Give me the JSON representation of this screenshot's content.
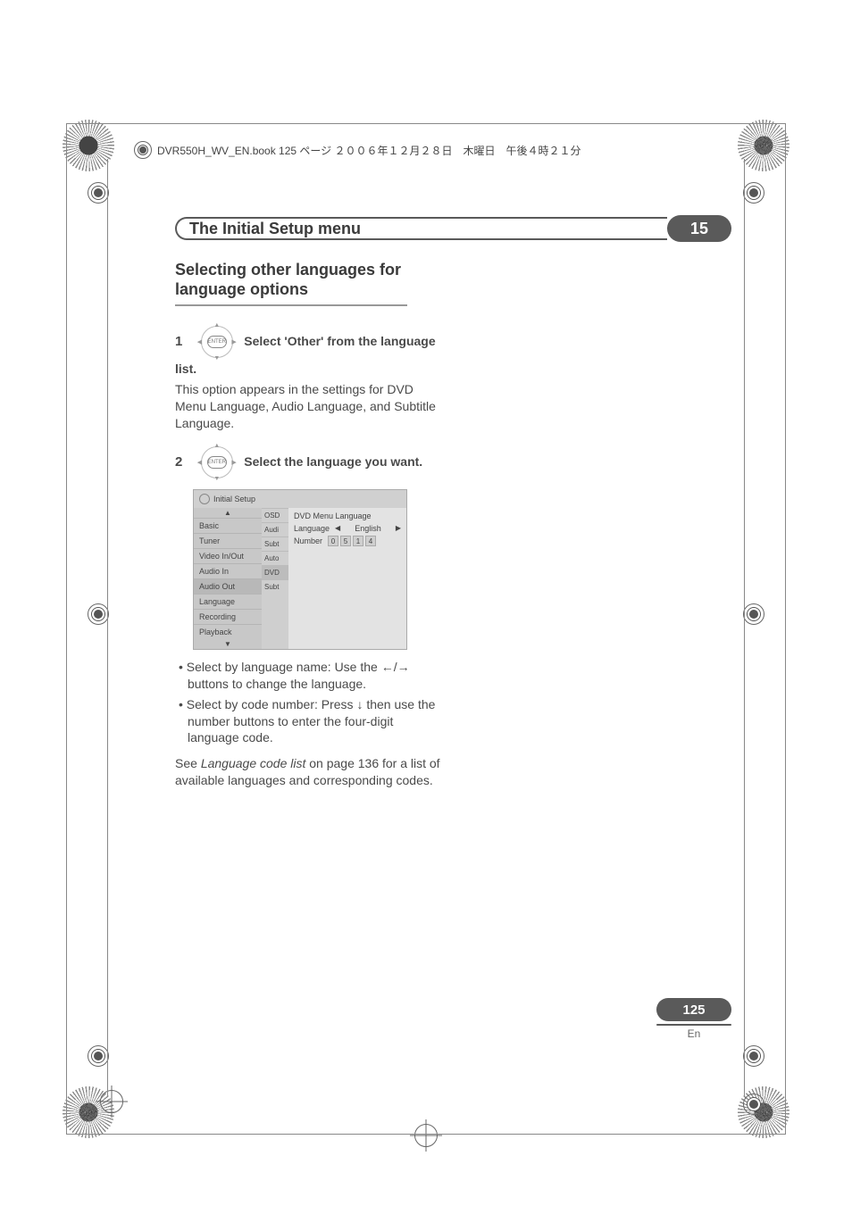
{
  "header_line": "DVR550H_WV_EN.book  125 ページ  ２００６年１２月２８日　木曜日　午後４時２１分",
  "chapter": {
    "title": "The Initial Setup menu",
    "number": "15"
  },
  "section_title": "Selecting other languages for language options",
  "enter_label": "ENTER",
  "step1": {
    "num": "1",
    "bold": "Select 'Other' from the language list.",
    "para": "This option appears in the settings for DVD Menu Language, Audio Language, and Subtitle Language."
  },
  "step2": {
    "num": "2",
    "bold": "Select the language you want."
  },
  "osd": {
    "title": "Initial Setup",
    "left": [
      "Basic",
      "Tuner",
      "Video In/Out",
      "Audio In",
      "Audio Out",
      "Language",
      "Recording",
      "Playback"
    ],
    "mid": [
      "OSD",
      "Audi",
      "Subt",
      "Auto",
      "DVD",
      "Subt"
    ],
    "right_header": "DVD Menu Language",
    "row_lang_label": "Language",
    "row_lang_value": "English",
    "row_num_label": "Number",
    "digits": [
      "0",
      "5",
      "1",
      "4"
    ]
  },
  "bullets": {
    "b1_pre": "Select by language name: Use the ",
    "b1_mid": "/",
    "b1_post": " buttons to change the language.",
    "b2_pre": "Select by code number: Press ",
    "b2_post": " then use the number buttons to enter the four-digit language code."
  },
  "ref": {
    "pre": "See ",
    "italic": "Language code list",
    "post": " on page 136 for a list of available languages and corresponding codes."
  },
  "page": {
    "num": "125",
    "lang": "En"
  },
  "glyphs": {
    "left": "←",
    "right": "→",
    "down": "↓",
    "tri_left": "◀",
    "tri_right": "▶",
    "tri_up": "▲",
    "tri_down": "▼"
  }
}
